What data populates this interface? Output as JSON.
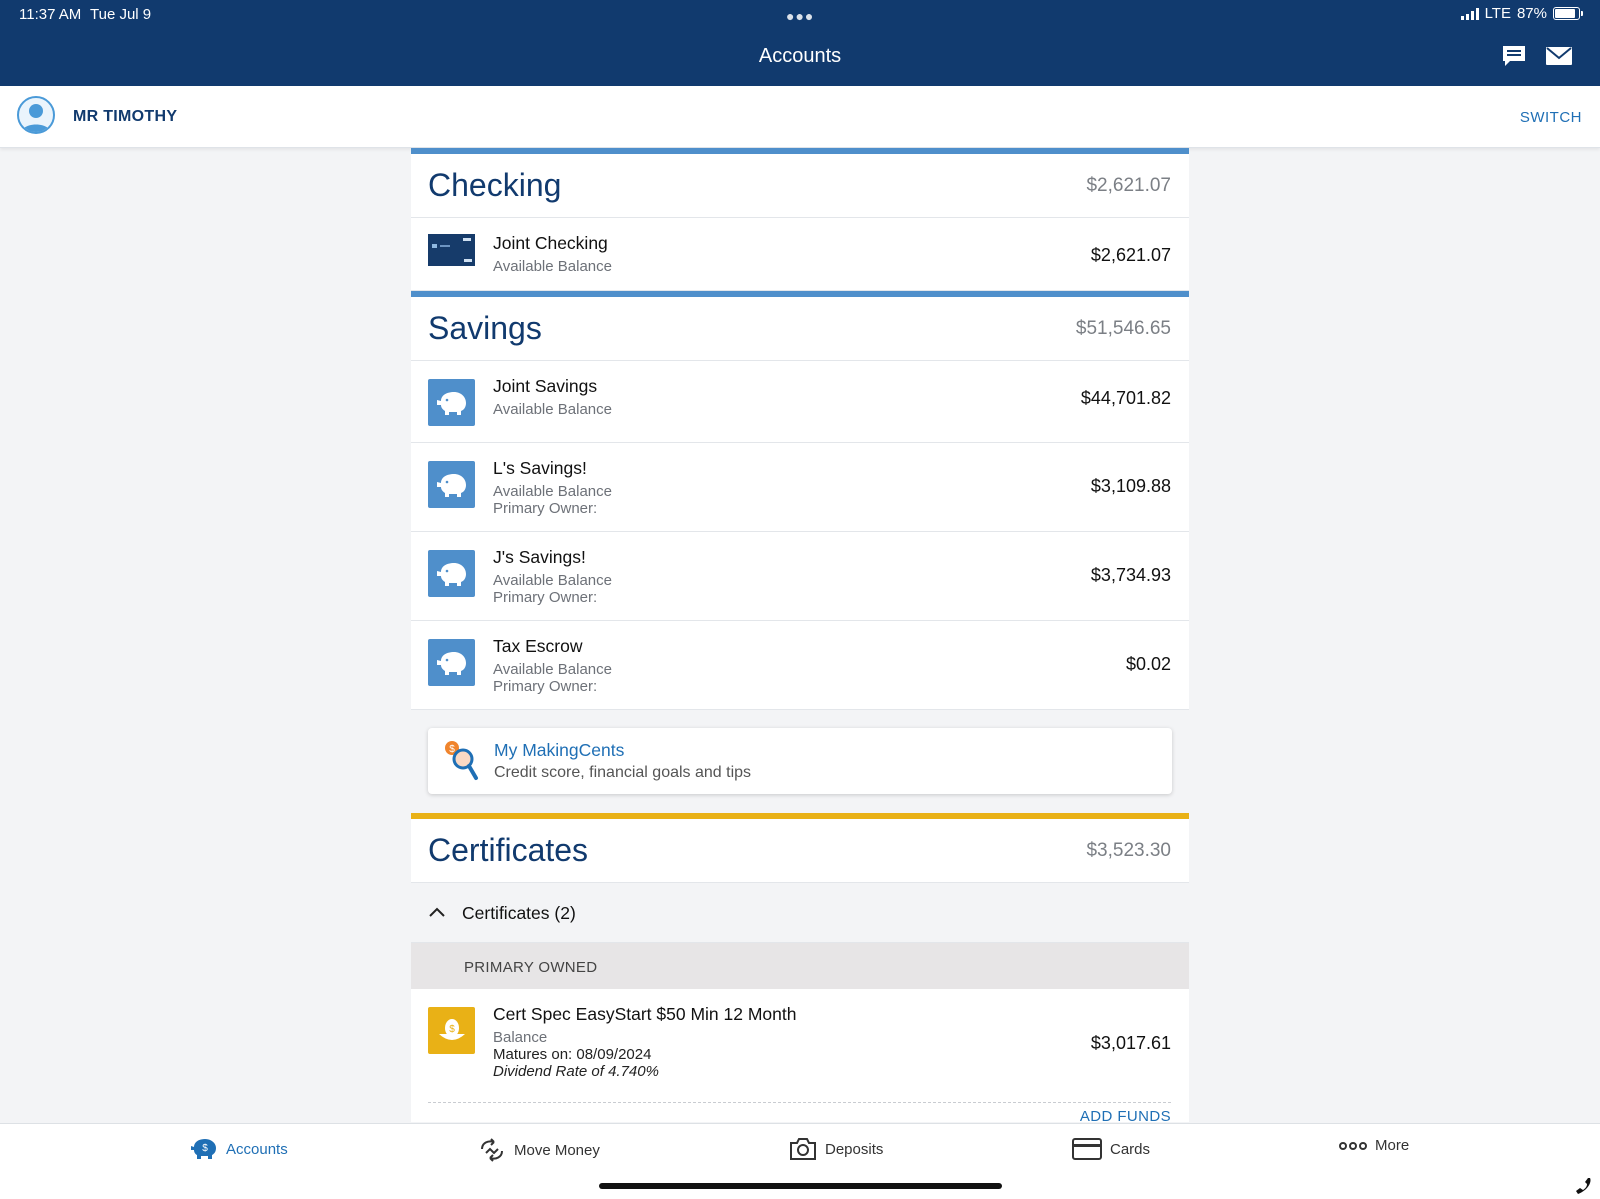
{
  "status_bar": {
    "time": "11:37 AM",
    "date": "Tue Jul 9",
    "network": "LTE",
    "battery": "87%"
  },
  "header": {
    "title": "Accounts"
  },
  "user": {
    "name": "MR TIMOTHY",
    "switch_label": "SWITCH"
  },
  "checking": {
    "title": "Checking",
    "total": "$2,621.07",
    "accounts": [
      {
        "name": "Joint Checking",
        "sub": "Available Balance",
        "amount": "$2,621.07"
      }
    ]
  },
  "savings": {
    "title": "Savings",
    "total": "$51,546.65",
    "accounts": [
      {
        "name": "Joint Savings",
        "sub": "Available Balance",
        "owner": "",
        "amount": "$44,701.82"
      },
      {
        "name": "L's Savings!",
        "sub": "Available Balance",
        "owner": "Primary Owner:",
        "amount": "$3,109.88"
      },
      {
        "name": "J's Savings!",
        "sub": "Available Balance",
        "owner": "Primary Owner:",
        "amount": "$3,734.93"
      },
      {
        "name": "Tax Escrow",
        "sub": "Available Balance",
        "owner": "Primary Owner:",
        "amount": "$0.02"
      }
    ]
  },
  "making_cents": {
    "title": "My MakingCents",
    "subtitle": "Credit score, financial goals and tips"
  },
  "certificates": {
    "title": "Certificates",
    "total": "$3,523.30",
    "group_label": "Certificates (2)",
    "owned_label": "PRIMARY OWNED",
    "items": [
      {
        "name": "Cert Spec EasyStart $50 Min 12 Month",
        "sub": "Balance",
        "matures": "Matures on: 08/09/2024",
        "rate": "Dividend Rate of 4.740%",
        "amount": "$3,017.61",
        "action": "ADD FUNDS"
      }
    ]
  },
  "tabs": [
    {
      "label": "Accounts",
      "icon": "piggy-dollar-icon",
      "active": true
    },
    {
      "label": "Move Money",
      "icon": "transfer-icon",
      "active": false
    },
    {
      "label": "Deposits",
      "icon": "camera-icon",
      "active": false
    },
    {
      "label": "Cards",
      "icon": "card-icon",
      "active": false
    },
    {
      "label": "More",
      "icon": "more-dots-icon",
      "active": false
    }
  ],
  "colors": {
    "header": "#113a6e",
    "accent": "#1f6fb5",
    "section_blue": "#4f8fcb",
    "section_gold": "#e9b116"
  }
}
